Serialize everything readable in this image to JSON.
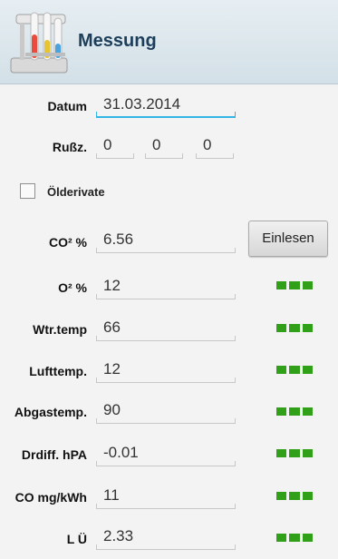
{
  "header": {
    "title": "Messung",
    "icon": "lab-test-tubes-icon"
  },
  "datum": {
    "label": "Datum",
    "value": "31.03.2014"
  },
  "russ": {
    "label": "Rußz.",
    "values": [
      "0",
      "0",
      "0"
    ]
  },
  "oelderivate": {
    "label": "Ölderivate",
    "checked": false
  },
  "read_button": {
    "label": "Einlesen"
  },
  "rows": [
    {
      "label": "CO² %",
      "value": "6.56"
    },
    {
      "label": "O² %",
      "value": "12"
    },
    {
      "label": "Wtr.temp",
      "value": "66"
    },
    {
      "label": "Lufttemp.",
      "value": "12"
    },
    {
      "label": "Abgastemp.",
      "value": "90"
    },
    {
      "label": "Drdiff. hPA",
      "value": "-0.01"
    },
    {
      "label": "CO mg/kWh",
      "value": "11"
    },
    {
      "label": "L Ü",
      "value": "2.33"
    }
  ],
  "status_color": "#2fa017"
}
